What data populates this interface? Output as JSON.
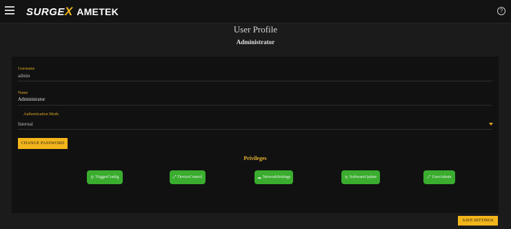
{
  "header": {
    "logo_surge": "SURGE",
    "logo_x": "X",
    "logo_ametek": "AMETEK",
    "menu_icon": "menu-icon",
    "help_icon": "help-icon",
    "help_glyph": "?"
  },
  "page": {
    "title": "User Profile",
    "subtitle": "Administrator"
  },
  "form": {
    "username_label": "Username",
    "username_value": "admin",
    "name_label": "Name",
    "name_value": "Administrator",
    "auth_label": "Authentication Mode",
    "auth_value": "Internal",
    "change_password_label": "CHANGE PASSWORD"
  },
  "privileges": {
    "title": "Privileges",
    "items": [
      {
        "label": "TriggerConfig",
        "icon": "location-icon",
        "glyph": "⚲"
      },
      {
        "label": "DeviceControl",
        "icon": "expand-icon",
        "glyph": "⤢"
      },
      {
        "label": "NetworkSettings",
        "icon": "network-icon",
        "glyph": "☁"
      },
      {
        "label": "SoftwareUpdate",
        "icon": "refresh-icon",
        "glyph": "↻"
      },
      {
        "label": "UserAdmin",
        "icon": "user-admin-icon",
        "glyph": "⤢"
      }
    ]
  },
  "footer": {
    "save_label": "SAVE SETTINGS"
  },
  "colors": {
    "accent": "#f2b51b",
    "privilege_green": "#3aad2f",
    "background": "#1b1b1b"
  }
}
